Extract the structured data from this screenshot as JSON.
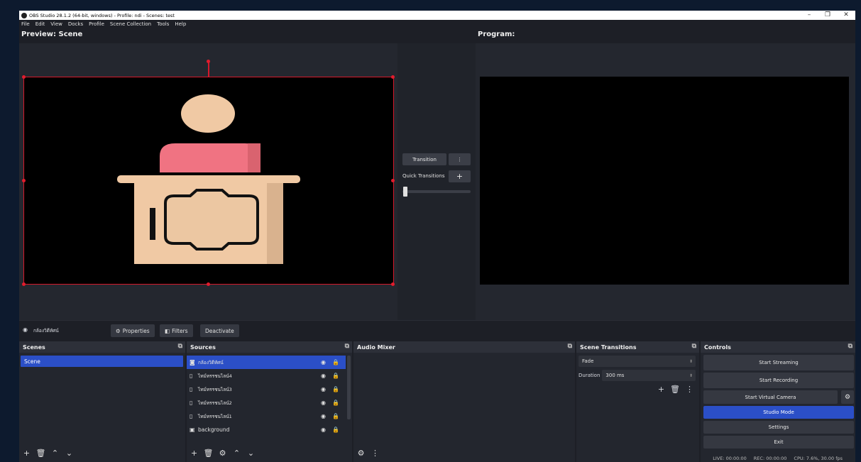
{
  "window": {
    "title": "OBS Studio 28.1.2 (64-bit, windows) - Profile: ndi - Scenes: test",
    "controls": [
      "–",
      "❐",
      "✕"
    ]
  },
  "menu": [
    "File",
    "Edit",
    "View",
    "Docks",
    "Profile",
    "Scene Collection",
    "Tools",
    "Help"
  ],
  "preview": {
    "title": "Preview: Scene"
  },
  "program": {
    "title": "Program:"
  },
  "transition_panel": {
    "transition_label": "Transition",
    "more_icon": "⋮",
    "quick_transitions_label": "Quick Transitions",
    "add_icon": "+"
  },
  "source_toolbar": {
    "selected_source": "กล้องวิดีทัศน์",
    "properties_label": "Properties",
    "filters_label": "Filters",
    "deactivate_label": "Deactivate"
  },
  "scenes_dock": {
    "title": "Scenes",
    "items": [
      "Scene"
    ]
  },
  "sources_dock": {
    "title": "Sources",
    "items": [
      {
        "name": "กล้องวิดีทัศน์",
        "icon": "camera-icon"
      },
      {
        "name": "ไทม์ทรรชนไลน์4",
        "icon": "file-icon"
      },
      {
        "name": "ไทม์ทรรชนไลน์3",
        "icon": "file-icon"
      },
      {
        "name": "ไทม์ทรรชนไลน์2",
        "icon": "file-icon"
      },
      {
        "name": "ไทม์ทรรชนไลน์1",
        "icon": "file-icon"
      },
      {
        "name": "background",
        "icon": "image-icon"
      }
    ]
  },
  "audio_mixer": {
    "title": "Audio Mixer"
  },
  "scene_transitions": {
    "title": "Scene Transitions",
    "transition": "Fade",
    "duration_label": "Duration",
    "duration_value": "300 ms"
  },
  "controls": {
    "title": "Controls",
    "start_streaming": "Start Streaming",
    "start_recording": "Start Recording",
    "start_virtual_camera": "Start Virtual Camera",
    "studio_mode": "Studio Mode",
    "settings": "Settings",
    "exit": "Exit"
  },
  "status": {
    "live": "LIVE: 00:00:00",
    "rec": "REC: 00:00:00",
    "cpu": "CPU: 7.6%, 30.00 fps"
  },
  "colors": {
    "accent": "#2b4fc7",
    "selection": "#d6182b",
    "head": "#f0c9a4",
    "body": "#f07382",
    "desk": "#f0c9a4"
  }
}
